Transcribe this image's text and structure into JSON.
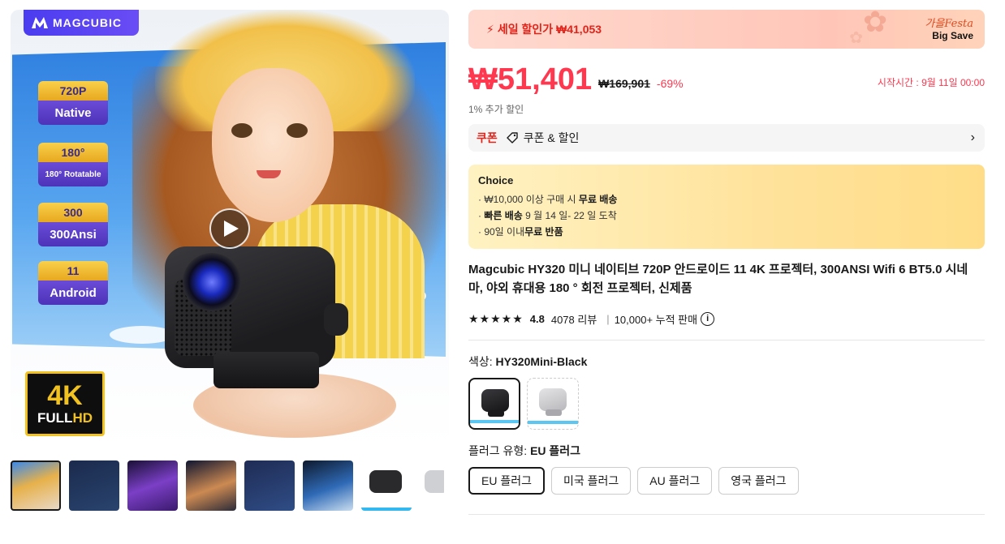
{
  "gallery": {
    "brand_badge": "MAGCUBIC",
    "features": [
      {
        "top": "720P",
        "bottom": "Native"
      },
      {
        "top": "180°",
        "bottom": "180° Rotatable"
      },
      {
        "top": "300",
        "bottom": "300Ansi"
      },
      {
        "top": "11",
        "bottom": "Android"
      }
    ],
    "badge_4k": {
      "main": "4K",
      "full": "FULL",
      "hd": "HD"
    },
    "video_icon": "play-icon",
    "thumbnails_count": 8,
    "active_thumbnail": 1
  },
  "sale": {
    "icon": "lightning-icon",
    "label": "세일 할인가 ₩41,053",
    "festa_top": "가을Festa",
    "festa_bottom": "Big Save"
  },
  "price": {
    "current": "₩51,401",
    "original": "₩169,901",
    "discount": "-69%",
    "start_time": "시작시간 : 9월 11일 00:00",
    "extra": "1% 추가 할인"
  },
  "coupon": {
    "title": "쿠폰",
    "icon": "tag-icon",
    "text": "쿠폰 & 할인",
    "chevron": "›"
  },
  "choice": {
    "title": "Choice",
    "lines": [
      {
        "pre": "· ₩10,000 이상 구매 시 ",
        "bold": "무료 배송",
        "post": ""
      },
      {
        "pre": "· ",
        "bold": "빠른 배송",
        "post": " 9 월 14 일- 22 일 도착"
      },
      {
        "pre": "· 90일 이내",
        "bold": "무료 반품",
        "post": ""
      }
    ]
  },
  "product": {
    "title": "Magcubic HY320 미니 네이티브 720P 안드로이드 11 4K 프로젝터, 300ANSI Wifi 6 BT5.0 시네마, 야외 휴대용 180 ° 회전 프로젝터, 신제품",
    "stars": "★★★★★",
    "rating": "4.8",
    "reviews": "4078 리뷰",
    "sep": "|",
    "sold": "10,000+ 누적 판매",
    "info_icon": "i"
  },
  "color": {
    "label": "색상: ",
    "value": "HY320Mini-Black",
    "options": [
      "black",
      "grey"
    ],
    "selected": "black"
  },
  "plug": {
    "label": "플러그 유형: ",
    "value": "EU 플러그",
    "options": [
      "EU 플러그",
      "미국 플러그",
      "AU 플러그",
      "영국 플러그"
    ]
  },
  "colors": {
    "accent": "#fd384f",
    "brand": "#4a3cf0",
    "choice_bg": "#ffe29a"
  }
}
